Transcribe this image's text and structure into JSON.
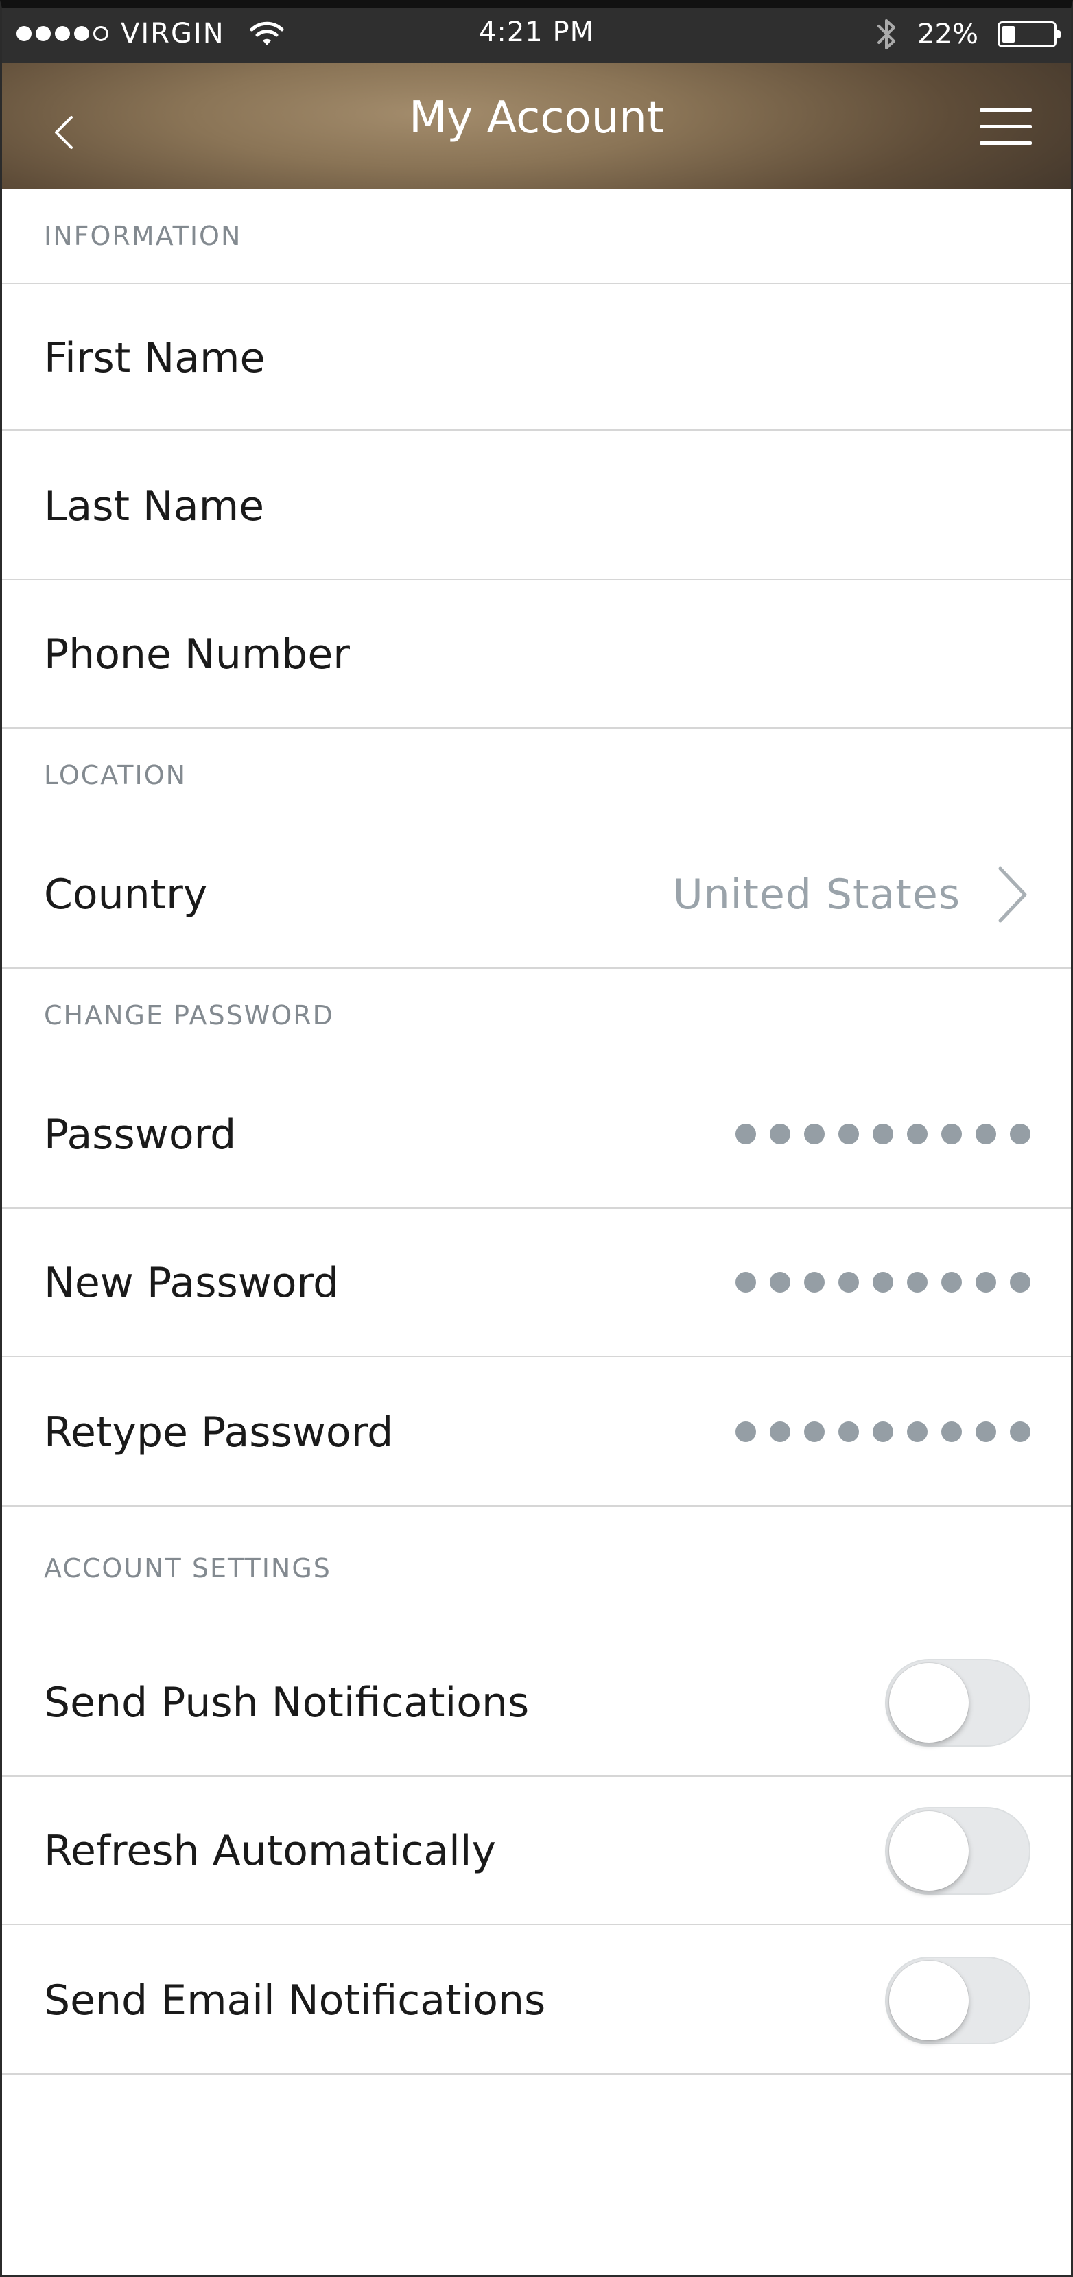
{
  "status_bar": {
    "carrier": "VIRGIN",
    "time": "4:21 PM",
    "battery": "22%",
    "battery_level": 0.22,
    "signal_bars": 4,
    "signal_total": 5
  },
  "nav": {
    "title": "My Account",
    "back_icon": "chevron-left-icon",
    "menu_icon": "hamburger-menu-icon"
  },
  "sections": {
    "information": "INFORMATION",
    "location": "LOCATION",
    "change_password": "CHANGE PASSWORD",
    "account_settings": "ACCOUNT SETTINGS"
  },
  "fields": {
    "first_name": {
      "label": "First Name",
      "value": ""
    },
    "last_name": {
      "label": "Last Name",
      "value": ""
    },
    "phone_number": {
      "label": "Phone Number",
      "value": ""
    },
    "country": {
      "label": "Country",
      "value": "United States"
    },
    "password": {
      "label": "Password",
      "masked_length": 9
    },
    "new_password": {
      "label": "New Password",
      "masked_length": 9
    },
    "retype_password": {
      "label": "Retype Password",
      "masked_length": 9
    }
  },
  "settings": {
    "push_notifications": {
      "label": "Send Push Notifications",
      "on": false
    },
    "refresh_automatically": {
      "label": "Refresh Automatically",
      "on": false
    },
    "email_notifications": {
      "label": "Send Email Notifications",
      "on": false
    }
  },
  "colors": {
    "section_header": "#838a90",
    "value_text": "#9aa3aa",
    "toggle_off": "#e6e8ea",
    "divider": "#d6d6d6"
  }
}
